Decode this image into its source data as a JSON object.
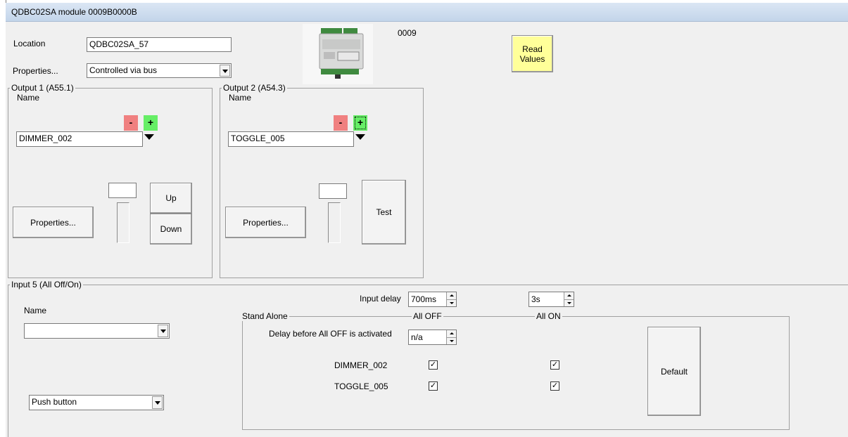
{
  "window": {
    "title": "QDBC02SA module 0009B0000B"
  },
  "header": {
    "location_label": "Location",
    "location_value": "QDBC02SA_57",
    "properties_label": "Properties...",
    "properties_value": "Controlled via bus",
    "module_code": "0009",
    "read_values_label": "Read Values"
  },
  "output1": {
    "group_label": "Output 1 (A55.1)",
    "name_label": "Name",
    "minus": "-",
    "plus": "+",
    "name_value": "DIMMER_002",
    "level_value": "",
    "properties_button": "Properties...",
    "up_button": "Up",
    "down_button": "Down"
  },
  "output2": {
    "group_label": "Output 2 (A54.3)",
    "name_label": "Name",
    "minus": "-",
    "plus": "+",
    "name_value": "TOGGLE_005",
    "level_value": "",
    "properties_button": "Properties...",
    "test_button": "Test"
  },
  "input5": {
    "group_label": "Input 5 (All Off/On)",
    "name_label": "Name",
    "name_value": "",
    "type_value": "Push button",
    "input_delay_label": "Input delay",
    "input_delay_value": "700ms",
    "second_delay_value": "3s",
    "standalone_label": "Stand Alone",
    "all_off_label": "All OFF",
    "all_on_label": "All ON",
    "delay_label": "Delay before All OFF is activated",
    "delay_value": "n/a",
    "rows": [
      {
        "name": "DIMMER_002",
        "all_off": true,
        "all_on": true
      },
      {
        "name": "TOGGLE_005",
        "all_off": true,
        "all_on": true
      }
    ],
    "default_button": "Default"
  },
  "colors": {
    "minus": "#f08080",
    "plus": "#66ee66",
    "read_values_bg": "#ffff99"
  }
}
